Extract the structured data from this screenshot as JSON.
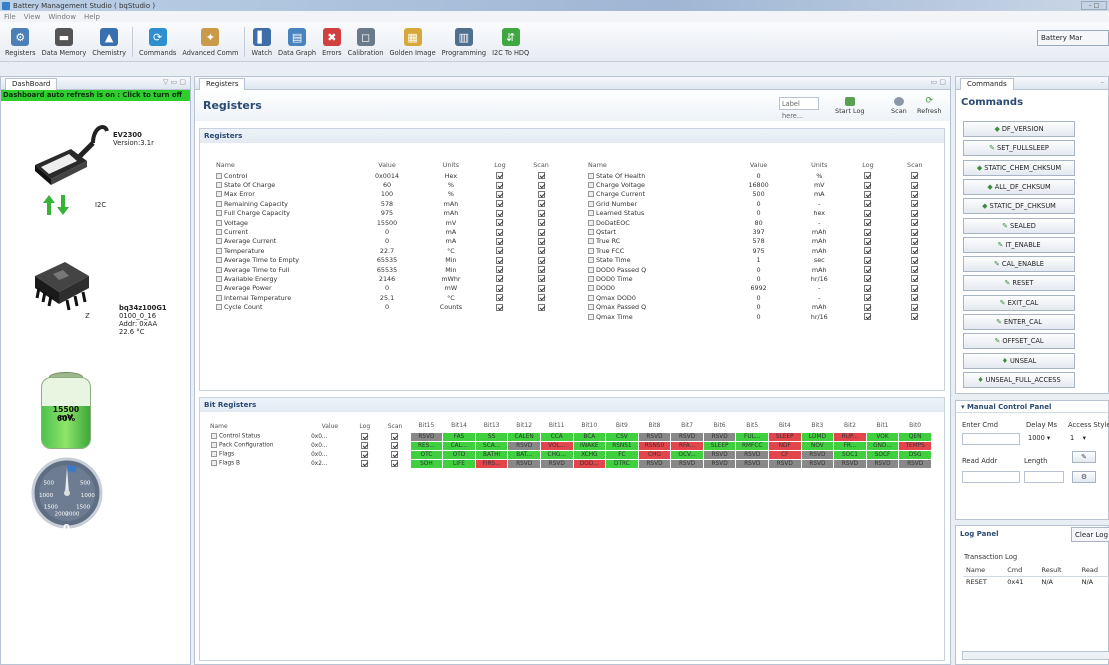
{
  "window": {
    "title": "Battery Management Studio ( bqStudio )",
    "controls": "– □"
  },
  "menu": [
    "File",
    "View",
    "Window",
    "Help"
  ],
  "toolbar": {
    "buttons": [
      {
        "label": "Registers",
        "icon": "registers-icon",
        "color": "#4a7fb8"
      },
      {
        "label": "Data Memory",
        "icon": "data-memory-icon",
        "color": "#555555"
      },
      {
        "label": "Chemistry",
        "icon": "chemistry-icon",
        "color": "#3a6fb0"
      },
      {
        "label": "Commands",
        "icon": "commands-icon",
        "color": "#2d8fd0"
      },
      {
        "label": "Advanced Comm",
        "icon": "advanced-comm-icon",
        "color": "#c89a4a"
      },
      {
        "label": "Watch",
        "icon": "watch-icon",
        "color": "#3f6da8"
      },
      {
        "label": "Data Graph",
        "icon": "data-graph-icon",
        "color": "#4a84c0"
      },
      {
        "label": "Errors",
        "icon": "errors-icon",
        "color": "#d04040"
      },
      {
        "label": "Calibration",
        "icon": "calibration-icon",
        "color": "#6a7a8a"
      },
      {
        "label": "Golden Image",
        "icon": "golden-image-icon",
        "color": "#d8a838"
      },
      {
        "label": "Programming",
        "icon": "programming-icon",
        "color": "#4f6f8f"
      },
      {
        "label": "I2C To HDQ",
        "icon": "i2c-to-hdq-icon",
        "color": "#40a840"
      }
    ],
    "right_label": "Battery Mar"
  },
  "dashboard": {
    "tab": "DashBoard",
    "banner": "Dashboard auto refresh is on : Click to turn off",
    "adapter_name": "EV2300",
    "adapter_version": "Version:3.1r",
    "bus": "I2C",
    "device_name": "bq34z100G1",
    "device_fw": "0100_0_16",
    "device_addr": "Addr: 0xAA",
    "device_temp": "22.6 °C",
    "battery_voltage": "15500 mV",
    "battery_percent": "60%",
    "battery_level": 0.6,
    "gauge_value": "0",
    "gauge_ticks": [
      "500",
      "1000",
      "1500",
      "2000",
      "2000",
      "1500",
      "1000",
      "500"
    ]
  },
  "registers": {
    "tab": "Registers",
    "title": "Registers",
    "label_placeholder": "Label here...",
    "start_log": "Start Log",
    "scan": "Scan",
    "refresh": "Refresh",
    "section_title": "Registers",
    "columns": [
      "Name",
      "Value",
      "Units",
      "Log",
      "Scan"
    ],
    "left": [
      [
        "Control",
        "0x0014",
        "Hex"
      ],
      [
        "State Of Charge",
        "60",
        "%"
      ],
      [
        "Max Error",
        "100",
        "%"
      ],
      [
        "Remaining Capacity",
        "578",
        "mAh"
      ],
      [
        "Full Charge Capacity",
        "975",
        "mAh"
      ],
      [
        "Voltage",
        "15500",
        "mV"
      ],
      [
        "Current",
        "0",
        "mA"
      ],
      [
        "Average Current",
        "0",
        "mA"
      ],
      [
        "Temperature",
        "22.7",
        "°C"
      ],
      [
        "Average Time to Empty",
        "65535",
        "Min"
      ],
      [
        "Average Time to Full",
        "65535",
        "Min"
      ],
      [
        "Available Energy",
        "2146",
        "mWhr"
      ],
      [
        "Average Power",
        "0",
        "mW"
      ],
      [
        "Internal Temperature",
        "25.1",
        "°C"
      ],
      [
        "Cycle Count",
        "0",
        "Counts"
      ]
    ],
    "right": [
      [
        "State Of Health",
        "0",
        "%"
      ],
      [
        "Charge Voltage",
        "16800",
        "mV"
      ],
      [
        "Charge Current",
        "500",
        "mA"
      ],
      [
        "Grid Number",
        "0",
        "-"
      ],
      [
        "Learned Status",
        "0",
        "hex"
      ],
      [
        "DoDatEOC",
        "80",
        "-"
      ],
      [
        "Qstart",
        "397",
        "mAh"
      ],
      [
        "True RC",
        "578",
        "mAh"
      ],
      [
        "True FCC",
        "975",
        "mAh"
      ],
      [
        "State Time",
        "1",
        "sec"
      ],
      [
        "DOD0 Passed Q",
        "0",
        "mAh"
      ],
      [
        "DOD0 Time",
        "0",
        "hr/16"
      ],
      [
        "DOD0",
        "6992",
        "-"
      ],
      [
        "Qmax DOD0",
        "0",
        "-"
      ],
      [
        "Qmax Passed Q",
        "0",
        "mAh"
      ],
      [
        "Qmax Time",
        "0",
        "hr/16"
      ]
    ]
  },
  "bit_registers": {
    "section_title": "Bit Registers",
    "columns": [
      "Name",
      "Value",
      "Log",
      "Scan",
      "Bit15",
      "Bit14",
      "Bit13",
      "Bit12",
      "Bit11",
      "Bit10",
      "Bit9",
      "Bit8",
      "Bit7",
      "Bit6",
      "Bit5",
      "Bit4",
      "Bit3",
      "Bit2",
      "Bit1",
      "Bit0"
    ],
    "rows": [
      {
        "name": "Control Status",
        "value": "0x0...",
        "bits": [
          [
            "RSVD",
            "y"
          ],
          [
            "FAS",
            "g"
          ],
          [
            "SS",
            "g"
          ],
          [
            "CALEN",
            "g"
          ],
          [
            "CCA",
            "g"
          ],
          [
            "BCA",
            "g"
          ],
          [
            "CSV",
            "g"
          ],
          [
            "RSVD",
            "y"
          ],
          [
            "RSVD",
            "y"
          ],
          [
            "RSVD",
            "y"
          ],
          [
            "FUL...",
            "g"
          ],
          [
            "SLEEP",
            "r"
          ],
          [
            "LDMD",
            "g"
          ],
          [
            "RUP...",
            "r"
          ],
          [
            "VOK",
            "g"
          ],
          [
            "QEN",
            "g"
          ]
        ]
      },
      {
        "name": "Pack Configuration",
        "value": "0x0...",
        "bits": [
          [
            "RES...",
            "g"
          ],
          [
            "CAL...",
            "g"
          ],
          [
            "SCA...",
            "g"
          ],
          [
            "RSVD",
            "y"
          ],
          [
            "VOL...",
            "r"
          ],
          [
            "IWAKE",
            "g"
          ],
          [
            "RSNS1",
            "g"
          ],
          [
            "RSNS0",
            "r"
          ],
          [
            "RFA...",
            "r"
          ],
          [
            "SLEEP",
            "g"
          ],
          [
            "RMFCC",
            "g"
          ],
          [
            "NDF",
            "r"
          ],
          [
            "NOV",
            "g"
          ],
          [
            "FR...",
            "g"
          ],
          [
            "GND...",
            "g"
          ],
          [
            "TEMPS",
            "r"
          ]
        ]
      },
      {
        "name": "Flags",
        "value": "0x0...",
        "bits": [
          [
            "OTC",
            "g"
          ],
          [
            "OTD",
            "g"
          ],
          [
            "BATHI",
            "g"
          ],
          [
            "BAT...",
            "g"
          ],
          [
            "CHG...",
            "g"
          ],
          [
            "XCHG",
            "g"
          ],
          [
            "FC",
            "g"
          ],
          [
            "CHG",
            "r"
          ],
          [
            "OCV...",
            "g"
          ],
          [
            "RSVD",
            "y"
          ],
          [
            "RSVD",
            "y"
          ],
          [
            "CF",
            "r"
          ],
          [
            "RSVD",
            "y"
          ],
          [
            "SOC1",
            "g"
          ],
          [
            "SOCF",
            "g"
          ],
          [
            "DSG",
            "g"
          ]
        ]
      },
      {
        "name": "Flags B",
        "value": "0x2...",
        "bits": [
          [
            "SOH",
            "g"
          ],
          [
            "LIFE",
            "g"
          ],
          [
            "FIRS...",
            "r"
          ],
          [
            "RSVD",
            "y"
          ],
          [
            "RSVD",
            "y"
          ],
          [
            "DOD...",
            "r"
          ],
          [
            "DTRC",
            "g"
          ],
          [
            "RSVD",
            "y"
          ],
          [
            "RSVD",
            "y"
          ],
          [
            "RSVD",
            "y"
          ],
          [
            "RSVD",
            "y"
          ],
          [
            "RSVD",
            "y"
          ],
          [
            "RSVD",
            "y"
          ],
          [
            "RSVD",
            "y"
          ],
          [
            "RSVD",
            "y"
          ],
          [
            "RSVD",
            "y"
          ]
        ]
      }
    ]
  },
  "commands": {
    "tab": "Commands",
    "title": "Commands",
    "items": [
      "DF_VERSION",
      "SET_FULLSLEEP",
      "STATIC_CHEM_CHKSUM",
      "ALL_DF_CHKSUM",
      "STATIC_DF_CHKSUM",
      "SEALED",
      "IT_ENABLE",
      "CAL_ENABLE",
      "RESET",
      "EXIT_CAL",
      "ENTER_CAL",
      "OFFSET_CAL",
      "UNSEAL",
      "UNSEAL_FULL_ACCESS"
    ]
  },
  "manual": {
    "title": "Manual Control Panel",
    "enter_cmd": "Enter Cmd",
    "delay": "Delay Ms",
    "access": "Access Style",
    "delay_value": "1000",
    "access_value": "1",
    "read_addr": "Read Addr",
    "length": "Length"
  },
  "log": {
    "title": "Log Panel",
    "clear": "Clear Log",
    "sub": "Transaction Log",
    "columns": [
      "Name",
      "Cmd",
      "Result",
      "Read"
    ],
    "rows": [
      [
        "RESET",
        "0x41",
        "N/A",
        "N/A"
      ]
    ]
  }
}
